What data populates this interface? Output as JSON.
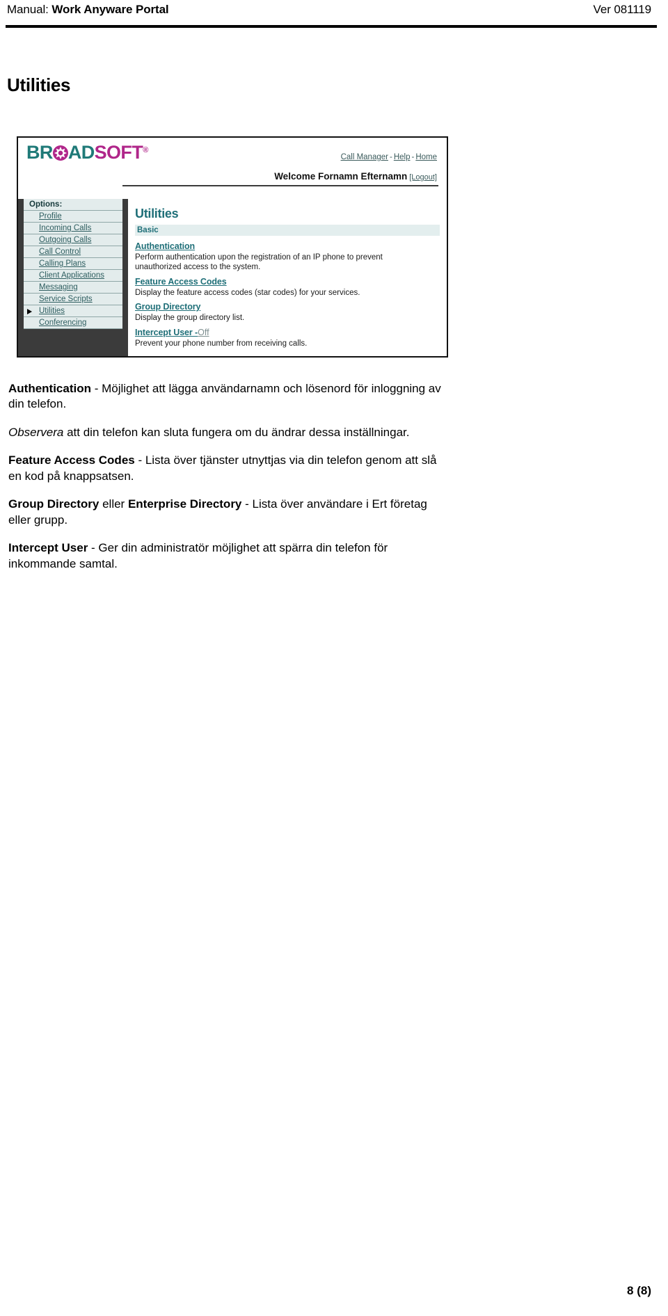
{
  "doc_header": {
    "manual_label": "Manual:",
    "document_title": "Work Anyware Portal",
    "version": "Ver 081119"
  },
  "page_title": "Utilities",
  "figure": {
    "logo": {
      "part1": "BR",
      "starburst_icon": "starburst-icon",
      "part2": "AD",
      "part3": "SOFT",
      "registered_mark": "®",
      "teal": "#1f7a78",
      "magenta": "#b0268a"
    },
    "topnav": [
      {
        "label": "Call Manager"
      },
      {
        "label": "Help"
      },
      {
        "label": "Home"
      }
    ],
    "topnav_separator": "-",
    "welcome": {
      "text": "Welcome Fornamn Efternamn",
      "logout": "[Logout]"
    },
    "sidebar": {
      "heading": "Options:",
      "items": [
        {
          "label": "Profile",
          "current": false
        },
        {
          "label": "Incoming Calls",
          "current": false
        },
        {
          "label": "Outgoing Calls",
          "current": false
        },
        {
          "label": "Call Control",
          "current": false
        },
        {
          "label": "Calling Plans",
          "current": false
        },
        {
          "label": "Client Applications",
          "current": false
        },
        {
          "label": "Messaging",
          "current": false
        },
        {
          "label": "Service Scripts",
          "current": false
        },
        {
          "label": "Utilities",
          "current": true
        },
        {
          "label": "Conferencing",
          "current": false
        }
      ]
    },
    "main": {
      "title": "Utilities",
      "section": "Basic",
      "entries": [
        {
          "title": "Authentication",
          "state": "",
          "desc": "Perform authentication upon the registration of an IP phone to prevent unauthorized access to the system."
        },
        {
          "title": "Feature Access Codes",
          "state": "",
          "desc": "Display the feature access codes (star codes) for your services."
        },
        {
          "title": "Group Directory",
          "state": "",
          "desc": "Display the group directory list."
        },
        {
          "title": "Intercept User - ",
          "state": "Off",
          "desc": "Prevent your phone number from receiving calls."
        }
      ]
    }
  },
  "body": {
    "paragraphs": [
      {
        "lead": "Authentication",
        "rest": " - Möjlighet att lägga användarnamn och lösenord för inloggning av din telefon."
      },
      {
        "italic_lead": "Observera",
        "rest": " att din telefon kan sluta fungera om du ändrar dessa inställningar."
      },
      {
        "lead": "Feature Access Codes",
        "rest": " - Lista över tjänster utnyttjas via din telefon genom att slå en kod på knappsatsen."
      },
      {
        "lead": "Group Directory",
        "mid": " eller ",
        "lead2": "Enterprise Directory",
        "rest": " - Lista över användare i Ert företag eller grupp."
      },
      {
        "lead": "Intercept User",
        "rest": " - Ger din administratör möjlighet att spärra din telefon för inkommande samtal."
      }
    ]
  },
  "footer": {
    "page_number": "8 (8)"
  }
}
